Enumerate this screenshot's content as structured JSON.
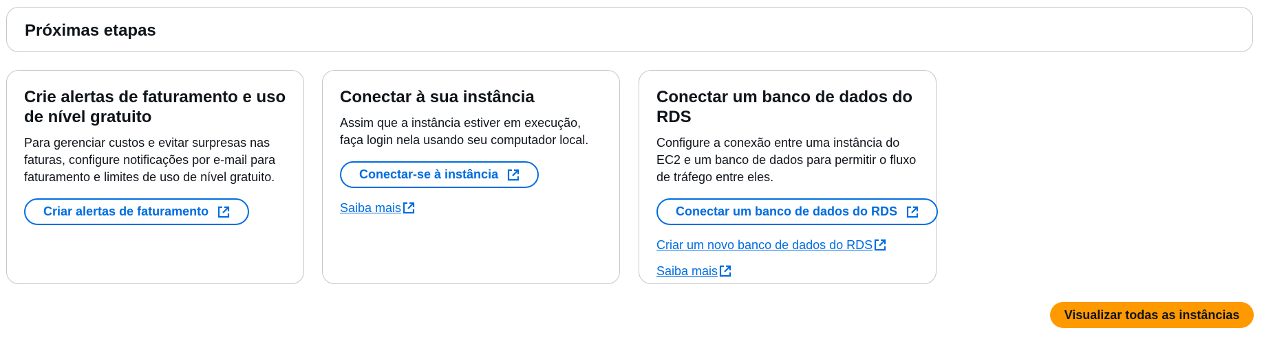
{
  "header": {
    "title": "Próximas etapas"
  },
  "cards": [
    {
      "title": "Crie alertas de faturamento e uso de nível gratuito",
      "description": "Para gerenciar custos e evitar surpresas nas faturas, configure notificações por e-mail para faturamento e limites de uso de nível gratuito.",
      "button_label": "Criar alertas de faturamento"
    },
    {
      "title": "Conectar à sua instância",
      "description": "Assim que a instância estiver em execução, faça login nela usando seu computador local.",
      "button_label": "Conectar-se à instância",
      "link_label": "Saiba mais"
    },
    {
      "title": "Conectar um banco de dados do RDS",
      "description": "Configure a conexão entre uma instância do EC2 e um banco de dados para permitir o fluxo de tráfego entre eles.",
      "button_label": "Conectar um banco de dados do RDS",
      "link1_label": "Criar um novo banco de dados do RDS",
      "link2_label": "Saiba mais"
    }
  ],
  "footer": {
    "primary_button_label": "Visualizar todas as instâncias"
  },
  "icons": {
    "external": "external-link-icon"
  },
  "colors": {
    "link": "#006ce0",
    "primary_button": "#ff9900",
    "border": "#c6c6cd"
  }
}
